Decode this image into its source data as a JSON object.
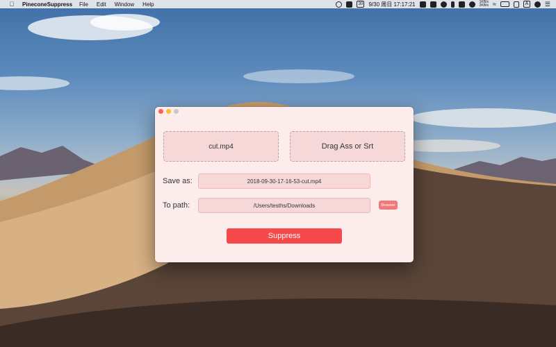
{
  "menubar": {
    "app_name": "PineconeSuppress",
    "items": [
      "File",
      "Edit",
      "Window",
      "Help"
    ],
    "calendar_day": "30",
    "clock": "9/30 周日 17:17:21",
    "net_up": "1KB/s",
    "net_down": "2KB/s",
    "input_source": "A"
  },
  "window": {
    "video_drop": "cut.mp4",
    "subtitle_drop": "Drag Ass or Srt",
    "save_as_label": "Save as:",
    "save_as_value": "2018-09-30-17-16-53-cut.mp4",
    "to_path_label": "To path:",
    "to_path_value": "/Users/tesths/Downloads",
    "browse_label": "Browser",
    "suppress_label": "Suppress"
  },
  "colors": {
    "window_bg": "#fdecec",
    "field_bg": "#f7d8d8",
    "accent": "#f5494c",
    "browse": "#f07a7a"
  }
}
